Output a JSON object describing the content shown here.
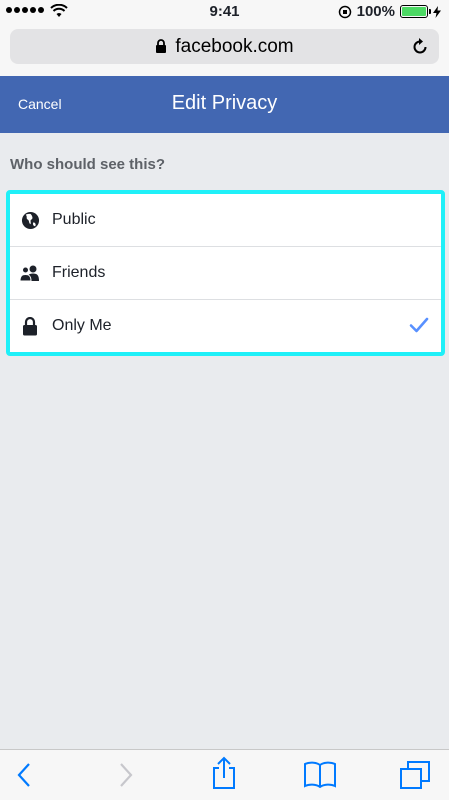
{
  "status_bar": {
    "time": "9:41",
    "battery_text": "100%"
  },
  "browser": {
    "url": "facebook.com"
  },
  "header": {
    "cancel_label": "Cancel",
    "title": "Edit Privacy"
  },
  "prompt": "Who should see this?",
  "options": [
    {
      "label": "Public",
      "icon": "globe-icon",
      "selected": false
    },
    {
      "label": "Friends",
      "icon": "friends-icon",
      "selected": false
    },
    {
      "label": "Only Me",
      "icon": "lock-icon",
      "selected": true
    }
  ],
  "colors": {
    "header_bg": "#4267b2",
    "highlight": "#1ff0f8",
    "check": "#5890ff",
    "page_bg": "#e9ebee"
  }
}
